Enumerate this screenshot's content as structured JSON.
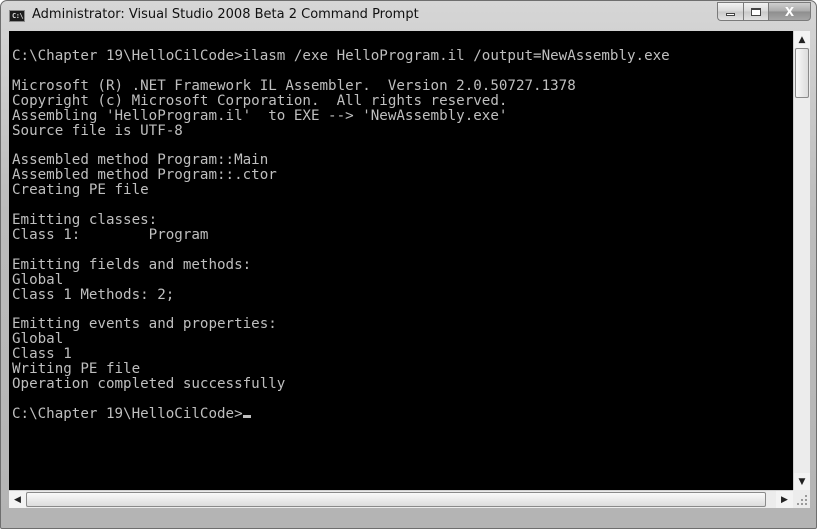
{
  "window": {
    "title": "Administrator: Visual Studio 2008 Beta 2 Command Prompt",
    "icon_label": "C:\\",
    "controls": {
      "close_label": "X"
    }
  },
  "console": {
    "lines": [
      "C:\\Chapter 19\\HelloCilCode>ilasm /exe HelloProgram.il /output=NewAssembly.exe",
      "",
      "Microsoft (R) .NET Framework IL Assembler.  Version 2.0.50727.1378",
      "Copyright (c) Microsoft Corporation.  All rights reserved.",
      "Assembling 'HelloProgram.il'  to EXE --> 'NewAssembly.exe'",
      "Source file is UTF-8",
      "",
      "Assembled method Program::Main",
      "Assembled method Program::.ctor",
      "Creating PE file",
      "",
      "Emitting classes:",
      "Class 1:        Program",
      "",
      "Emitting fields and methods:",
      "Global",
      "Class 1 Methods: 2;",
      "",
      "Emitting events and properties:",
      "Global",
      "Class 1",
      "Writing PE file",
      "Operation completed successfully",
      "",
      "C:\\Chapter 19\\HelloCilCode>"
    ]
  }
}
